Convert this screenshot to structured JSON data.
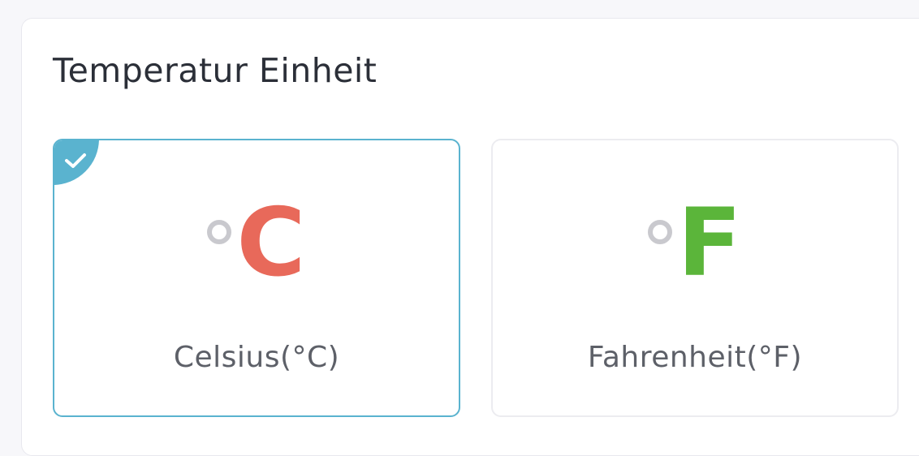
{
  "section": {
    "title": "Temperatur Einheit"
  },
  "options": [
    {
      "symbol": "C",
      "label": "Celsius(°C)",
      "color": "#e8695a",
      "selected": true
    },
    {
      "symbol": "F",
      "label": "Fahrenheit(°F)",
      "color": "#5bb53a",
      "selected": false
    }
  ],
  "colors": {
    "accent": "#5ab3cf",
    "degree": "#c9c9ce",
    "title_text": "#2b2f38",
    "label_text": "#5d6068"
  },
  "icons": {
    "selected_badge": "check-icon",
    "degree_mark": "degree-icon"
  }
}
